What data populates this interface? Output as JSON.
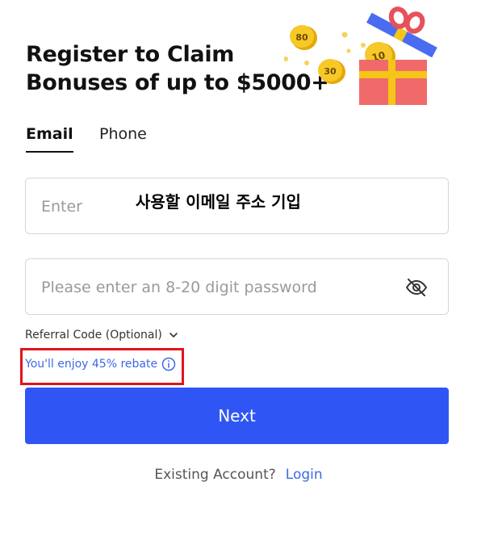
{
  "header": {
    "title_line1": "Register to Claim",
    "title_line2": "Bonuses of up to $5000+"
  },
  "hero": {
    "coin_labels": [
      "80",
      "30",
      "10"
    ],
    "icon": "gift-box-with-coins"
  },
  "tabs": [
    {
      "label": "Email",
      "active": true
    },
    {
      "label": "Phone",
      "active": false
    }
  ],
  "email_field": {
    "placeholder": "Enter",
    "overlay_text": "사용할 이메일 주소 기입"
  },
  "password_field": {
    "placeholder": "Please enter an 8-20 digit password",
    "icon": "eye-off-icon"
  },
  "referral": {
    "label": "Referral Code (Optional)",
    "icon": "chevron-down-icon"
  },
  "rebate": {
    "text": "You'll enjoy 45% rebate",
    "icon": "info-icon"
  },
  "next_button": {
    "label": "Next"
  },
  "footer": {
    "question": "Existing Account?",
    "login_label": "Login"
  },
  "colors": {
    "primary": "#2f56f5",
    "link": "#3d68e6",
    "highlight_border": "#e0141e",
    "coin": "#f5c518",
    "gift": "#f06a6a"
  }
}
